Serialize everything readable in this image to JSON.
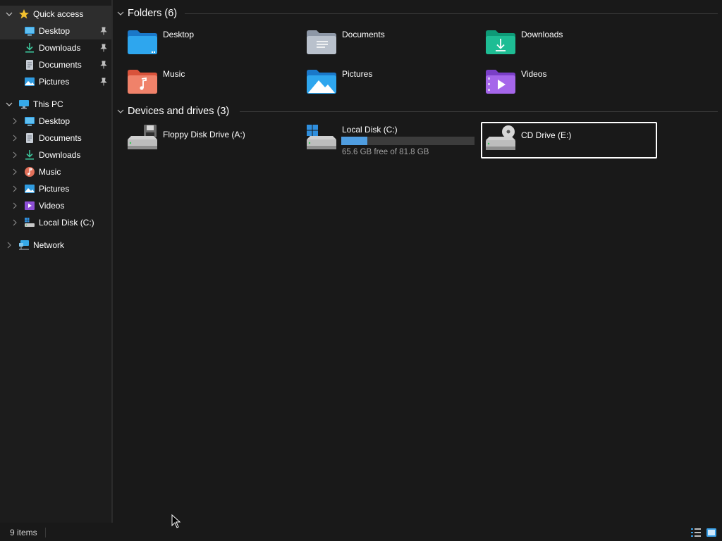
{
  "sidebar": {
    "quick_access": {
      "label": "Quick access",
      "items": [
        {
          "label": "Desktop",
          "pinned": true
        },
        {
          "label": "Downloads",
          "pinned": true
        },
        {
          "label": "Documents",
          "pinned": true
        },
        {
          "label": "Pictures",
          "pinned": true
        }
      ]
    },
    "this_pc": {
      "label": "This PC",
      "items": [
        {
          "label": "Desktop"
        },
        {
          "label": "Documents"
        },
        {
          "label": "Downloads"
        },
        {
          "label": "Music"
        },
        {
          "label": "Pictures"
        },
        {
          "label": "Videos"
        },
        {
          "label": "Local Disk (C:)"
        }
      ]
    },
    "network": {
      "label": "Network"
    }
  },
  "main": {
    "folders": {
      "title": "Folders (6)",
      "items": [
        {
          "label": "Desktop",
          "icon": "desktop-folder-icon"
        },
        {
          "label": "Documents",
          "icon": "documents-folder-icon"
        },
        {
          "label": "Downloads",
          "icon": "downloads-folder-icon"
        },
        {
          "label": "Music",
          "icon": "music-folder-icon"
        },
        {
          "label": "Pictures",
          "icon": "pictures-folder-icon"
        },
        {
          "label": "Videos",
          "icon": "videos-folder-icon"
        }
      ]
    },
    "devices": {
      "title": "Devices and drives (3)",
      "items": [
        {
          "label": "Floppy Disk Drive (A:)",
          "icon": "floppy-drive-icon"
        },
        {
          "label": "Local Disk (C:)",
          "icon": "local-disk-icon",
          "usage_text": "65.6 GB free of 81.8 GB",
          "used_fraction": 0.198
        },
        {
          "label": "CD Drive (E:)",
          "icon": "cd-drive-icon",
          "selected": true
        }
      ]
    }
  },
  "status": {
    "item_count": "9 items"
  },
  "colors": {
    "background": "#191919",
    "sidebar_active": "#2d2d2d",
    "accent_bar": "#4f9de0",
    "selection_border": "#ffffff"
  }
}
